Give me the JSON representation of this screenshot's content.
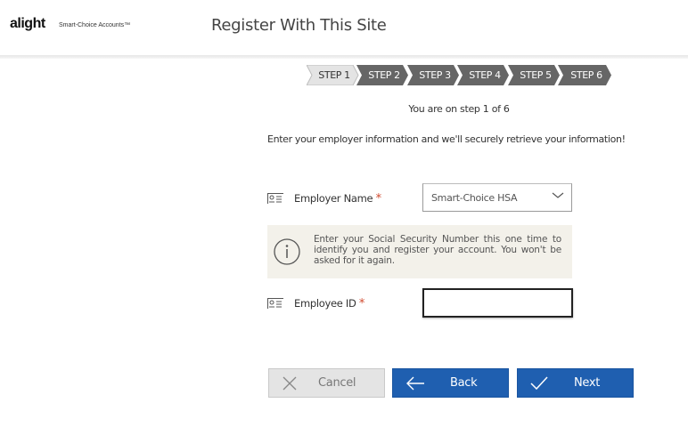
{
  "header": {
    "logo_text": "alight",
    "logo_subtitle": "Smart-Choice Accounts™",
    "title": "Register With This Site"
  },
  "steps": [
    "STEP 1",
    "STEP 2",
    "STEP 3",
    "STEP 4",
    "STEP 5",
    "STEP 6"
  ],
  "active_step": 1,
  "step_counter": "You are on step 1 of 6",
  "intro": "Enter your employer information and we'll securely retrieve your information!",
  "form": {
    "employer_label": "Employer Name",
    "employer_value": "Smart-Choice HSA",
    "required_mark": "*",
    "info_text": "Enter your Social Security Number this one time to identify you and register your account. You won't be asked for it again.",
    "employee_id_label": "Employee ID",
    "employee_id_value": ""
  },
  "buttons": {
    "cancel": "Cancel",
    "back": "Back",
    "next": "Next"
  },
  "colors": {
    "step_active_bg": "#e4e4e4",
    "step_inactive_bg": "#666666",
    "primary": "#1f5fb0",
    "required": "#d0492e",
    "info_bg": "#f3f1ea"
  }
}
